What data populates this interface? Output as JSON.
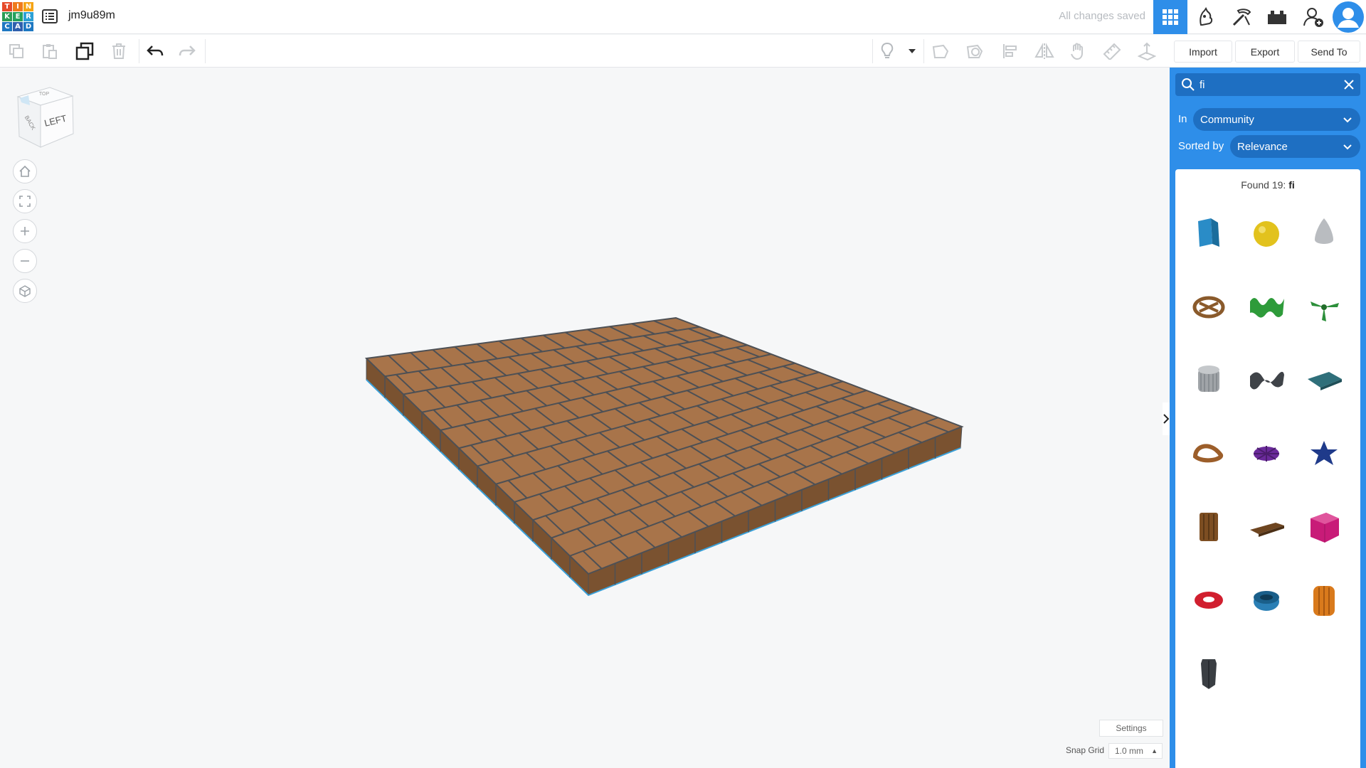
{
  "app": {
    "logo_letters": [
      "T",
      "I",
      "N",
      "K",
      "E",
      "R",
      "C",
      "A",
      "D"
    ],
    "logo_colors": [
      "#e64a2a",
      "#ef7b1c",
      "#f5a414",
      "#2c9c56",
      "#25a15d",
      "#2ca0d5",
      "#1e78c2",
      "#2f5fad",
      "#1e78c2"
    ],
    "design_title": "jm9u89m",
    "save_status": "All changes saved"
  },
  "top_icons": [
    "grid-3d-view-icon",
    "blocks-icon",
    "minecraft-pickaxe-icon",
    "bricks-icon",
    "add-user-icon",
    "user-avatar-icon"
  ],
  "toolbar": {
    "import_label": "Import",
    "export_label": "Export",
    "send_to_label": "Send To"
  },
  "viewcube": {
    "left_face": "LEFT",
    "back_face": "BACK",
    "top_face": "TOP"
  },
  "panel": {
    "search_value": "fi",
    "in_label": "In",
    "in_value": "Community",
    "sort_label": "Sorted by",
    "sort_value": "Relevance",
    "found_prefix": "Found 19:",
    "found_query": "fi",
    "results": [
      {
        "name": "blue-bent-plate",
        "color": "#2a8cc7"
      },
      {
        "name": "yellow-sphere",
        "color": "#e2c21d"
      },
      {
        "name": "grey-cone",
        "color": "#b9bcc0"
      },
      {
        "name": "brown-pretzel",
        "color": "#8a5a2b"
      },
      {
        "name": "green-wave-sheet",
        "color": "#2e9b3a"
      },
      {
        "name": "green-propeller",
        "color": "#2c8f3a"
      },
      {
        "name": "grey-gear-cylinder",
        "color": "#a0a4a8"
      },
      {
        "name": "dark-grey-wave",
        "color": "#3f4348"
      },
      {
        "name": "teal-mesh-plate",
        "color": "#2f6f7a"
      },
      {
        "name": "brown-ring-loop",
        "color": "#9c5e2a"
      },
      {
        "name": "purple-gear",
        "color": "#6b2a9b"
      },
      {
        "name": "navy-star",
        "color": "#1f3a8a"
      },
      {
        "name": "brown-column",
        "color": "#7d4e22"
      },
      {
        "name": "brown-plank",
        "color": "#6e4520"
      },
      {
        "name": "magenta-box",
        "color": "#c81b78"
      },
      {
        "name": "red-torus",
        "color": "#d11f2f"
      },
      {
        "name": "blue-ring",
        "color": "#2a7fb5"
      },
      {
        "name": "orange-column",
        "color": "#d97a1c"
      },
      {
        "name": "dark-column",
        "color": "#3a3e43"
      }
    ]
  },
  "bottom": {
    "settings_label": "Settings",
    "snap_label": "Snap Grid",
    "snap_value": "1.0 mm"
  },
  "colors": {
    "accent": "#2e8ee9",
    "brick": "#a8744a",
    "brick_side": "#7a5230",
    "mortar": "#4d5055"
  }
}
